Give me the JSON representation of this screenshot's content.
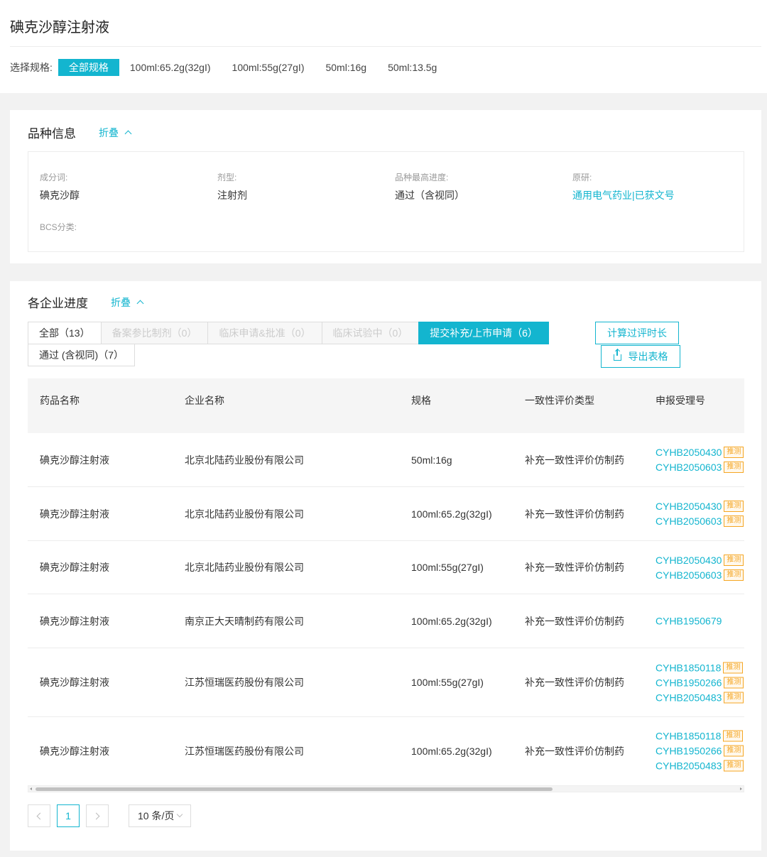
{
  "header": {
    "title": "碘克沙醇注射液"
  },
  "spec_filter": {
    "label": "选择规格:",
    "options": [
      "全部规格",
      "100ml:65.2g(32gI)",
      "100ml:55g(27gI)",
      "50ml:16g",
      "50ml:13.5g"
    ],
    "selected": "全部规格"
  },
  "variety_info": {
    "title": "品种信息",
    "collapse_label": "折叠",
    "fields": {
      "ingredient": {
        "label": "成分词:",
        "value": "碘克沙醇"
      },
      "dosage_form": {
        "label": "剂型:",
        "value": "注射剂"
      },
      "max_progress": {
        "label": "品种最高进度:",
        "value": "通过（含视同）"
      },
      "originator": {
        "label": "原研:",
        "value": "通用电气药业|已获文号"
      },
      "bcs": {
        "label": "BCS分类:",
        "value": ""
      }
    }
  },
  "progress": {
    "title": "各企业进度",
    "collapse_label": "折叠",
    "tabs": [
      {
        "label": "全部（13）"
      },
      {
        "label": "备案参比制剂（0）"
      },
      {
        "label": "临床申请&批准（0）"
      },
      {
        "label": "临床试验中（0）"
      },
      {
        "label": "提交补充/上市申请（6）"
      },
      {
        "label": "通过 (含视同)（7）"
      }
    ],
    "calc_button": "计算过评时长",
    "export_button": "导出表格",
    "columns": [
      "药品名称",
      "企业名称",
      "规格",
      "一致性评价类型",
      "申报受理号"
    ],
    "tag_label": "推测",
    "rows": [
      {
        "drug": "碘克沙醇注射液",
        "company": "北京北陆药业股份有限公司",
        "spec": "50ml:16g",
        "type": "补充一致性评价仿制药",
        "numbers": [
          "CYHB2050430",
          "CYHB2050603"
        ]
      },
      {
        "drug": "碘克沙醇注射液",
        "company": "北京北陆药业股份有限公司",
        "spec": "100ml:65.2g(32gI)",
        "type": "补充一致性评价仿制药",
        "numbers": [
          "CYHB2050430",
          "CYHB2050603"
        ]
      },
      {
        "drug": "碘克沙醇注射液",
        "company": "北京北陆药业股份有限公司",
        "spec": "100ml:55g(27gI)",
        "type": "补充一致性评价仿制药",
        "numbers": [
          "CYHB2050430",
          "CYHB2050603"
        ]
      },
      {
        "drug": "碘克沙醇注射液",
        "company": "南京正大天晴制药有限公司",
        "spec": "100ml:65.2g(32gI)",
        "type": "补充一致性评价仿制药",
        "numbers": [
          "CYHB1950679"
        ]
      },
      {
        "drug": "碘克沙醇注射液",
        "company": "江苏恒瑞医药股份有限公司",
        "spec": "100ml:55g(27gI)",
        "type": "补充一致性评价仿制药",
        "numbers": [
          "CYHB1850118",
          "CYHB1950266",
          "CYHB2050483"
        ]
      },
      {
        "drug": "碘克沙醇注射液",
        "company": "江苏恒瑞医药股份有限公司",
        "spec": "100ml:65.2g(32gI)",
        "type": "补充一致性评价仿制药",
        "numbers": [
          "CYHB1850118",
          "CYHB1950266",
          "CYHB2050483"
        ]
      }
    ]
  },
  "pagination": {
    "current_page": "1",
    "page_size": "10 条/页"
  },
  "colors": {
    "accent": "#13b5cf",
    "tag": "#f5a623"
  }
}
